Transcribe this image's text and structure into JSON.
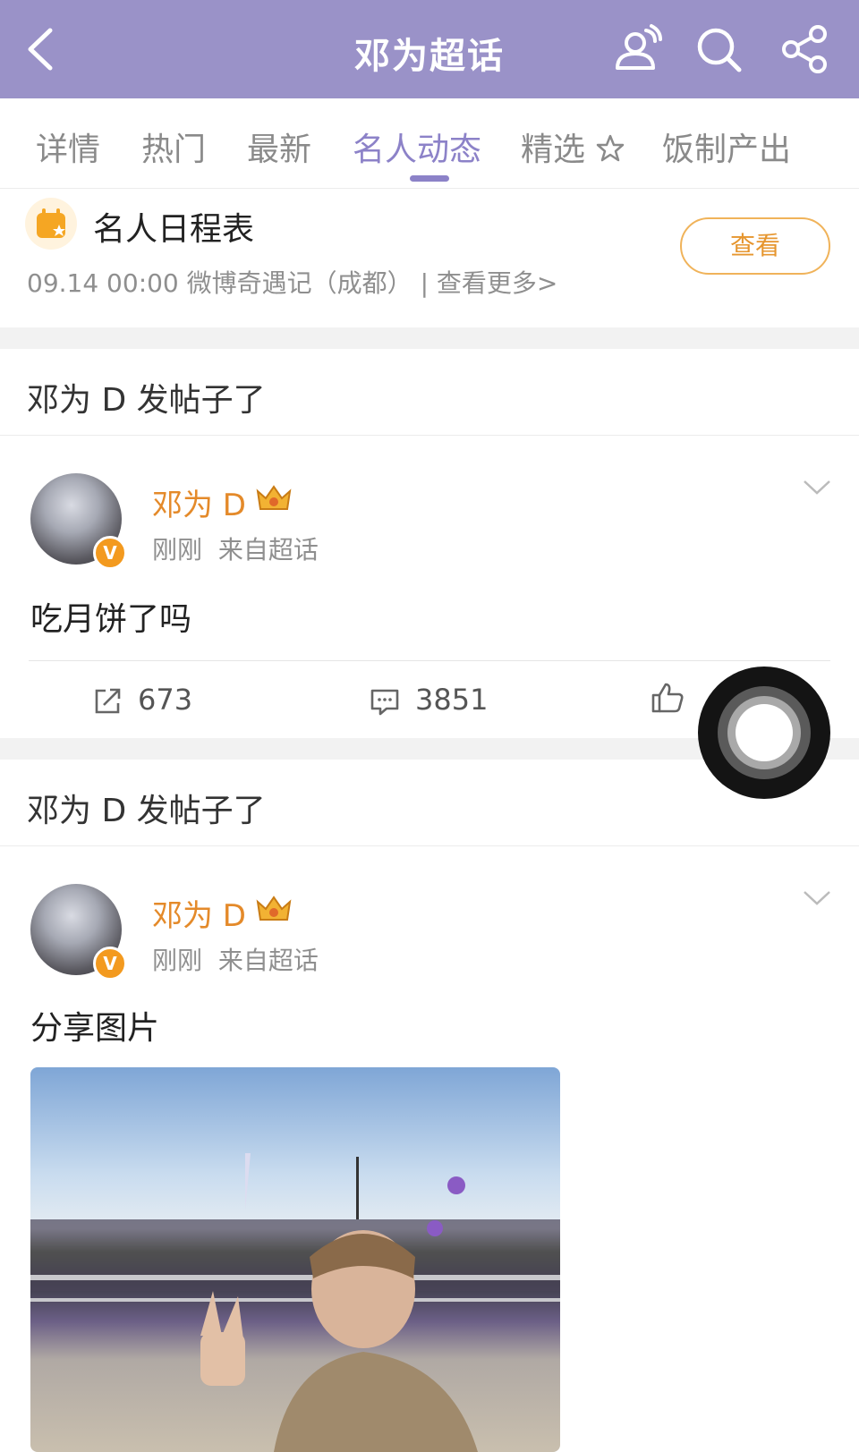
{
  "header": {
    "title": "邓为超话",
    "icons": [
      "back-icon",
      "user-group-icon",
      "search-icon",
      "share-icon"
    ]
  },
  "tabs": [
    {
      "label": "详情"
    },
    {
      "label": "热门"
    },
    {
      "label": "最新"
    },
    {
      "label": "名人动态",
      "active": true
    },
    {
      "label": "精选"
    },
    {
      "label": "饭制产出"
    }
  ],
  "schedule": {
    "label": "名人日程表",
    "time": "09.14 00:00",
    "event": "微博奇遇记（成都）",
    "separator": "|",
    "more": "查看更多>",
    "button": "查看"
  },
  "posts": [
    {
      "section_title": "邓为 D 发帖子了",
      "author": "邓为 D",
      "time": "刚刚",
      "source": "来自超话",
      "verified_badge": "V",
      "text": "吃月饼了吗",
      "reposts": "673",
      "comments": "3851"
    },
    {
      "section_title": "邓为 D 发帖子了",
      "author": "邓为 D",
      "time": "刚刚",
      "source": "来自超话",
      "verified_badge": "V",
      "text": "分享图片"
    }
  ],
  "colors": {
    "header_bg": "#9a92c8",
    "accent": "#8c82c8",
    "name": "#e48a2a",
    "button_border": "#f0b35a"
  }
}
